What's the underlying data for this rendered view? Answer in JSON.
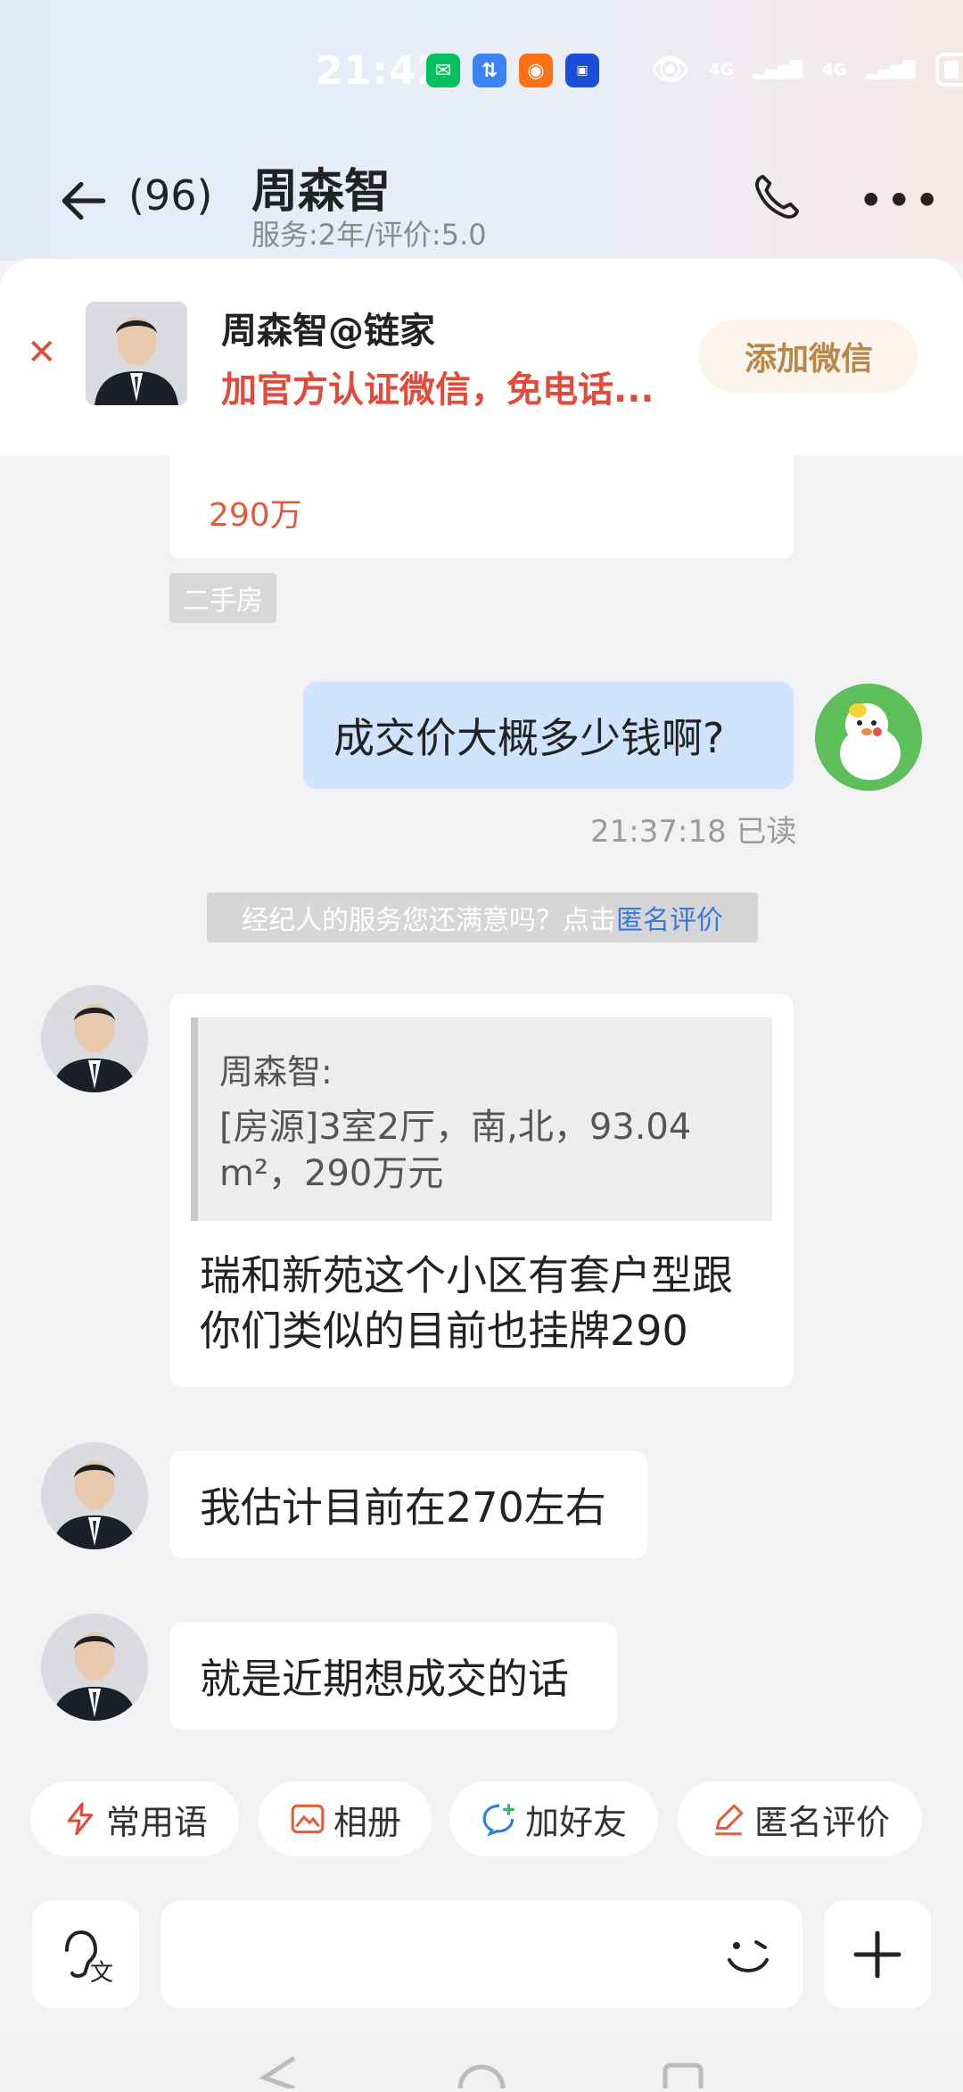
{
  "status_bar": {
    "time": "21:42",
    "app_icons": [
      "wechat-icon",
      "data-sync-icon",
      "app-icon",
      "autohome-icon"
    ],
    "signal": [
      "4G",
      "4G"
    ],
    "colors": {
      "wechat": "#07c160",
      "sync": "#3b82f6",
      "app": "#f97316",
      "autohome": "#1d4ed8"
    }
  },
  "header": {
    "unread_count": "(96)",
    "name": "周森智",
    "subtitle": "服务:2年/评价:5.0"
  },
  "promo": {
    "title": "周森智@链家",
    "description": "加官方认证微信，免电话...",
    "button": "添加微信"
  },
  "messages": {
    "previous_card_price": "290万",
    "tag": "二手房",
    "my_question": "成交价大概多少钱啊?",
    "timestamp": "21:37:18 已读",
    "system_note_prefix": "经纪人的服务您还满意吗？点击",
    "system_note_link": "匿名评价",
    "quote_author": "周森智:",
    "quote_text": "[房源]3室2厅，南,北，93.04 m²，290万元",
    "reply_1": "瑞和新苑这个小区有套户型跟你们类似的目前也挂牌290",
    "reply_2": "我估计目前在270左右",
    "reply_3": "就是近期想成交的话"
  },
  "quick_actions": [
    {
      "label": "常用语",
      "icon": "lightning-icon"
    },
    {
      "label": "相册",
      "icon": "photo-icon"
    },
    {
      "label": "加好友",
      "icon": "add-friend-icon"
    },
    {
      "label": "匿名评价",
      "icon": "edit-icon"
    }
  ],
  "input": {
    "placeholder": ""
  },
  "accent_colors": {
    "red": "#e04b3b",
    "blue_bubble": "#cfe3fc",
    "link": "#3a78d8"
  }
}
